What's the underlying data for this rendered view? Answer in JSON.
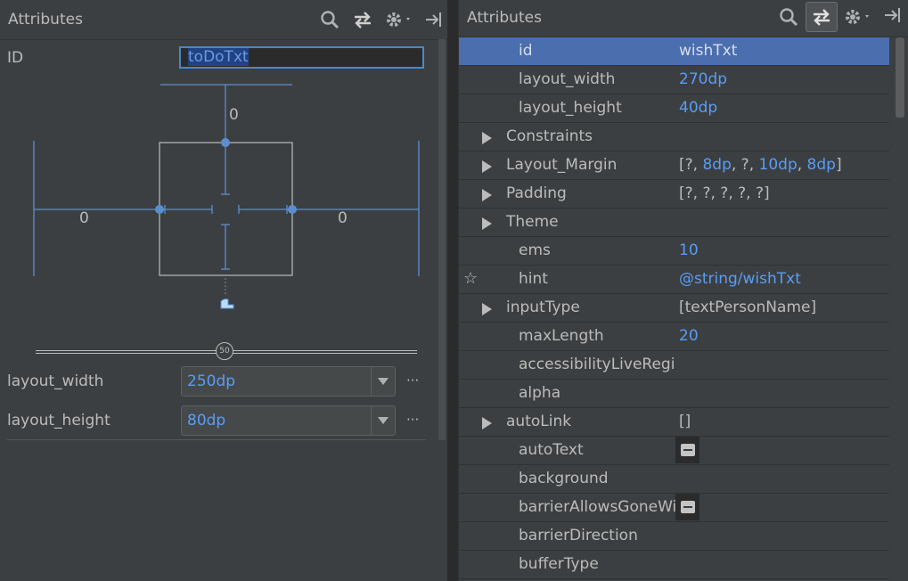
{
  "left_panel": {
    "title": "Attributes",
    "id_label": "ID",
    "id_value": "toDoTxt",
    "margins": {
      "top": "0",
      "left": "0",
      "right": "0"
    },
    "bias_value": "50",
    "layout_width_label": "layout_width",
    "layout_width_value": "250dp",
    "layout_height_label": "layout_height",
    "layout_height_value": "80dp",
    "more": "···"
  },
  "right_panel": {
    "title": "Attributes",
    "rows": [
      {
        "name": "id",
        "value": "wishTxt",
        "selected": true
      },
      {
        "name": "layout_width",
        "value": "270dp"
      },
      {
        "name": "layout_height",
        "value": "40dp"
      },
      {
        "name": "Constraints",
        "expandable": true
      },
      {
        "name": "Layout_Margin",
        "expandable": true
      },
      {
        "name": "Padding",
        "expandable": true,
        "value": "[?, ?, ?, ?, ?]"
      },
      {
        "name": "Theme",
        "expandable": true
      },
      {
        "name": "ems",
        "value": "10"
      },
      {
        "name": "hint",
        "value": "@string/wishTxt",
        "starred": true
      },
      {
        "name": "inputType",
        "expandable": true,
        "value": "[textPersonName]"
      },
      {
        "name": "maxLength",
        "value": "20"
      },
      {
        "name": "accessibilityLiveRegion"
      },
      {
        "name": "alpha"
      },
      {
        "name": "autoLink",
        "expandable": true,
        "value": "[]"
      },
      {
        "name": "autoText",
        "value_button": true
      },
      {
        "name": "background"
      },
      {
        "name": "barrierAllowsGoneWidgets",
        "value_button": true
      },
      {
        "name": "barrierDirection"
      },
      {
        "name": "bufferType"
      }
    ],
    "layout_margin_parts": [
      "[?, ",
      "8dp",
      ", ?, ",
      "10dp",
      ", ",
      "8dp",
      "]"
    ]
  },
  "icons": [
    "search-icon",
    "swap-icon",
    "gear-icon",
    "pin-icon",
    "expand-triangle-icon",
    "star-icon",
    "remove-icon",
    "chevron-down-icon"
  ],
  "colors": {
    "accent": "#589df6",
    "selected_row": "#4b6eaf",
    "constraint_line": "#5b8ed1",
    "bg": "#3c3f41"
  }
}
